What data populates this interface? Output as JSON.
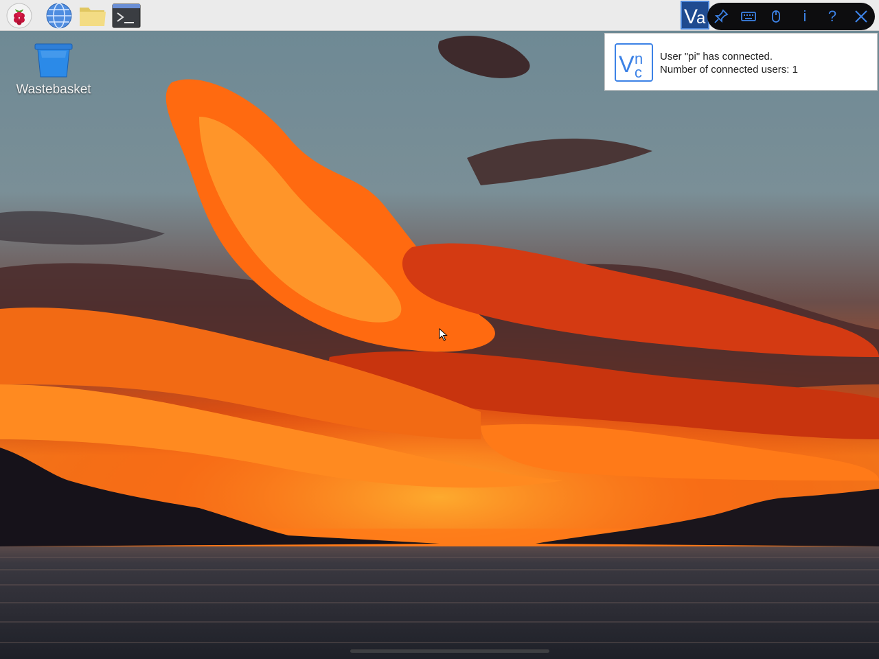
{
  "taskbar": {
    "launchers": [
      {
        "name": "raspberry-menu-icon"
      },
      {
        "name": "web-browser-icon"
      },
      {
        "name": "file-manager-icon"
      },
      {
        "name": "terminal-icon"
      }
    ]
  },
  "desktop": {
    "icons": [
      {
        "label": "Wastebasket",
        "icon": "wastebasket-icon"
      }
    ]
  },
  "vnc_toolbar": {
    "tray_icon": "vnc-server-icon",
    "buttons": [
      "pin-icon",
      "keyboard-icon",
      "mouse-icon",
      "info",
      "help",
      "close-icon"
    ],
    "info_label": "i",
    "help_label": "?"
  },
  "notification": {
    "icon": "vnc-logo-icon",
    "line1": "User \"pi\" has connected.",
    "line2": "Number of connected users: 1"
  },
  "colors": {
    "taskbar": "#ebebeb",
    "vnc_accent": "#3c82e6",
    "sky": "#6f8a94",
    "sunset_orange": "#ff6a10",
    "water": "#2a2c34"
  }
}
